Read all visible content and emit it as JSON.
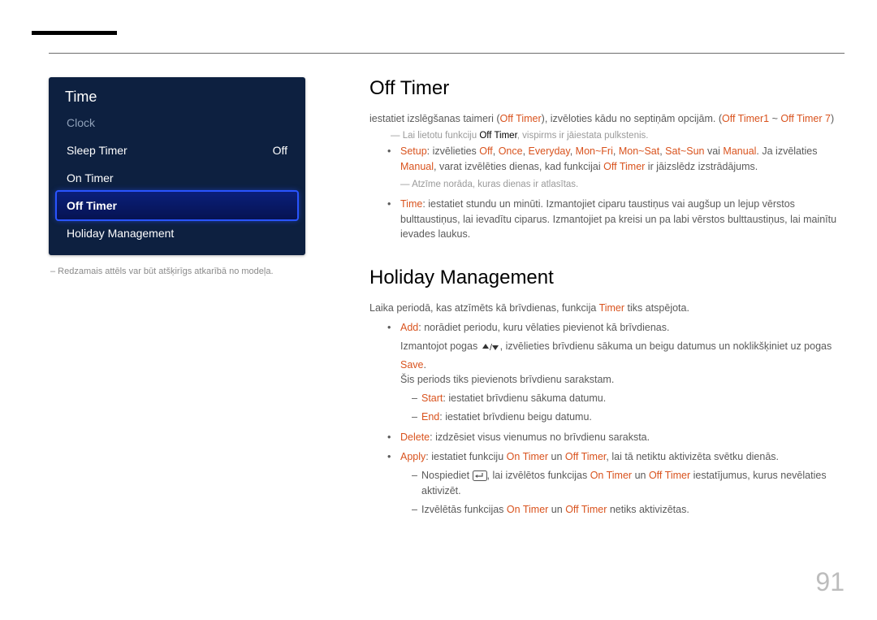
{
  "menu": {
    "title": "Time",
    "items": [
      {
        "label": "Clock"
      },
      {
        "label": "Sleep Timer",
        "value": "Off"
      },
      {
        "label": "On Timer"
      },
      {
        "label": "Off Timer"
      },
      {
        "label": "Holiday Management"
      }
    ],
    "note": "– Redzamais attēls var būt atšķirīgs atkarībā no modeļa."
  },
  "offtimer": {
    "heading": "Off Timer",
    "lead_pre": "iestatiet izslēgšanas taimeri (",
    "lead_kw1": "Off Timer",
    "lead_mid": "), izvēloties kādu no septiņām opcijām. (",
    "lead_kw2": "Off Timer1",
    "lead_tilde": " ~ ",
    "lead_kw3": "Off Timer 7",
    "lead_post": ")",
    "tip1_pre": "Lai lietotu funkciju ",
    "tip1_kw": "Off Timer",
    "tip1_post": ", vispirms ir jāiestata pulkstenis.",
    "setup_kw": "Setup",
    "setup_txt": ": izvēlieties ",
    "opt_off": "Off",
    "c1": ", ",
    "opt_once": "Once",
    "c2": ", ",
    "opt_every": "Everyday",
    "c3": ", ",
    "opt_mf": "Mon~Fri",
    "c4": ", ",
    "opt_ms": "Mon~Sat",
    "c5": ", ",
    "opt_ss": "Sat~Sun",
    "c6": " vai ",
    "opt_man": "Manual",
    "setup_post1": ". Ja izvēlaties ",
    "setup_post_kw": "Manual",
    "setup_post2": ", varat izvēlēties dienas, kad funkcijai ",
    "setup_post_kw2": "Off Timer",
    "setup_post3": " ir jāizslēdz izstrādājums.",
    "tip2": "Atzīme norāda, kuras dienas ir atlasītas.",
    "time_kw": "Time",
    "time_txt": ": iestatiet stundu un minūti. Izmantojiet ciparu taustiņus vai augšup un lejup vērstos bulttaustiņus, lai ievadītu ciparus. Izmantojiet pa kreisi un pa labi vērstos bulttaustiņus, lai mainītu ievades laukus."
  },
  "holiday": {
    "heading": "Holiday Management",
    "lead_pre": "Laika periodā, kas atzīmēts kā brīvdienas, funkcija ",
    "lead_kw": "Timer",
    "lead_post": " tiks atspējota.",
    "add_kw": "Add",
    "add_txt": ": norādiet periodu, kuru vēlaties pievienot kā brīvdienas.",
    "add_sub1_pre": "Izmantojot pogas ",
    "add_sub1_post": ", izvēlieties brīvdienu sākuma un beigu datumus un noklikšķiniet uz pogas ",
    "add_sub1_kw": "Save",
    "add_sub1_end": ".",
    "add_sub2": "Šis periods tiks pievienots brīvdienu sarakstam.",
    "start_kw": "Start",
    "start_txt": ": iestatiet brīvdienu sākuma datumu.",
    "end_kw": "End",
    "end_txt": ": iestatiet brīvdienu beigu datumu.",
    "delete_kw": "Delete",
    "delete_txt": ": izdzēsiet visus vienumus no brīvdienu saraksta.",
    "apply_kw": "Apply",
    "apply_txt1": ": iestatiet funkciju ",
    "apply_kw1": "On Timer",
    "apply_and": " un ",
    "apply_kw2": "Off Timer",
    "apply_txt2": ", lai tā netiktu aktivizēta svētku dienās.",
    "apply_s1_pre": "Nospiediet ",
    "apply_s1_post": ", lai izvēlētos funkcijas ",
    "apply_s1_kw1": "On Timer",
    "apply_s1_and": " un ",
    "apply_s1_kw2": "Off Timer",
    "apply_s1_end": " iestatījumus, kurus nevēlaties aktivizēt.",
    "apply_s2_pre": "Izvēlētās funkcijas ",
    "apply_s2_kw1": "On Timer",
    "apply_s2_and": " un ",
    "apply_s2_kw2": "Off Timer",
    "apply_s2_end": " netiks aktivizētas."
  },
  "page": "91"
}
